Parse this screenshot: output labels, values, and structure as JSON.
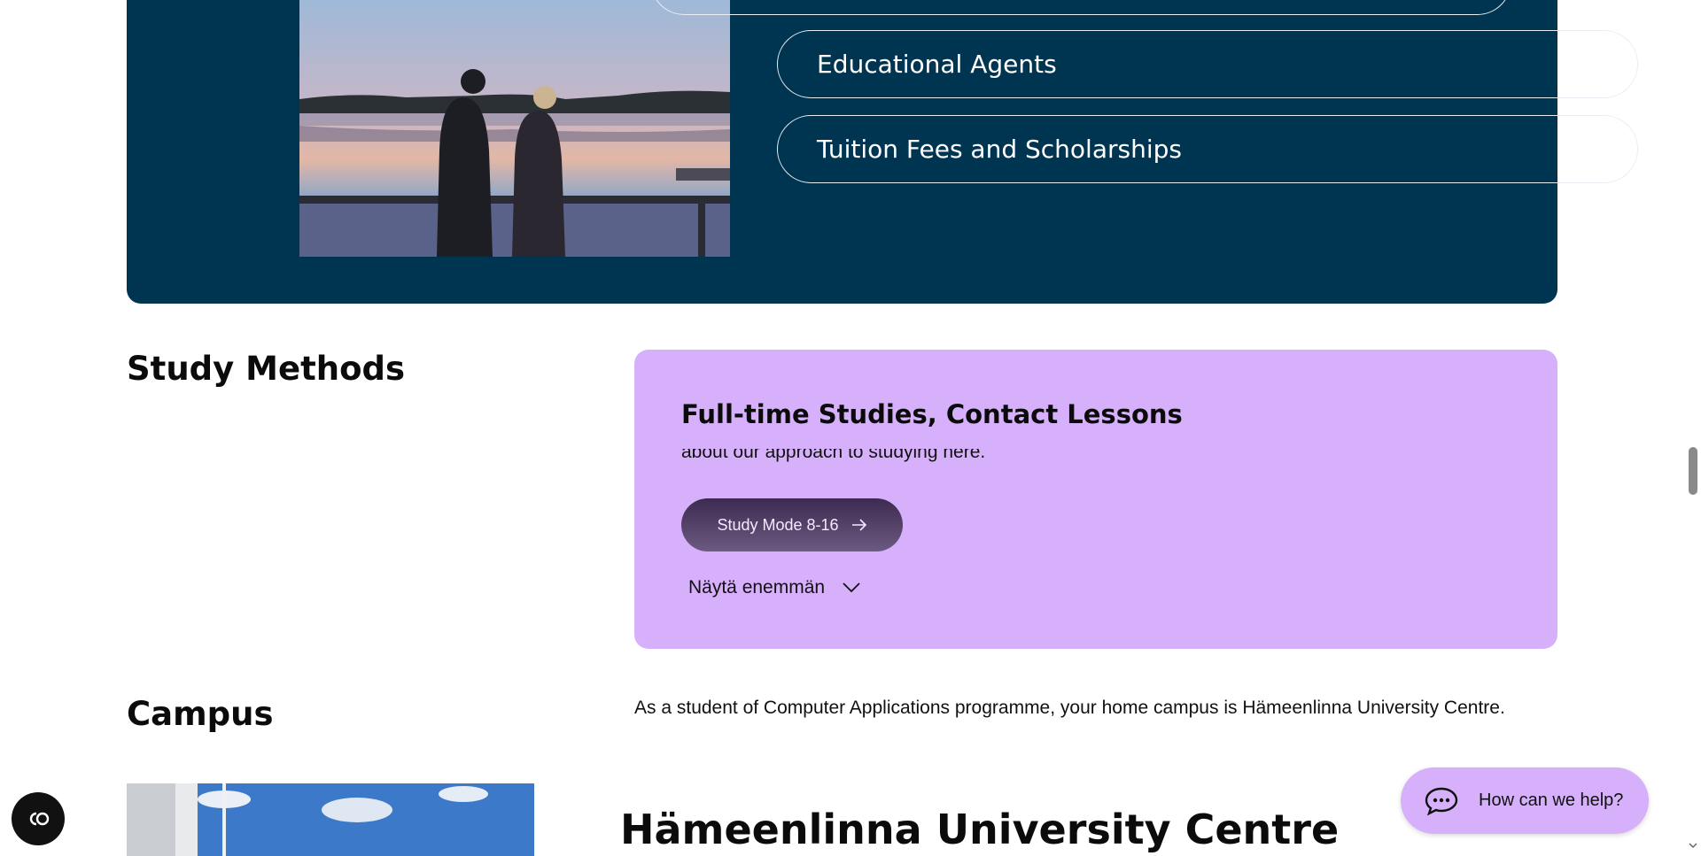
{
  "top_panel": {
    "links": [
      {
        "label": "Educational Agents"
      },
      {
        "label": "Tuition Fees and Scholarships"
      }
    ]
  },
  "study_methods": {
    "heading": "Study Methods",
    "card": {
      "title": "Full-time Studies, Contact Lessons",
      "text": "about our approach to studying here.",
      "mode_button": "Study Mode 8-16",
      "show_more": "Näytä enemmän",
      "background": "#d6b0fb"
    }
  },
  "campus": {
    "heading": "Campus",
    "text": "As a student of Computer Applications programme, your home campus is Hämeenlinna University Centre.",
    "centre_heading": "Hämeenlinna University Centre"
  },
  "help": {
    "label": "How can we help?"
  },
  "icons": {
    "arrow": "arrow-right-icon",
    "chat": "chat-bubble-icon",
    "chevron": "chevron-down-icon",
    "accessibility": "accessibility-icon"
  },
  "colors": {
    "panel": "#003552",
    "accent_purple": "#d6b0fb"
  }
}
